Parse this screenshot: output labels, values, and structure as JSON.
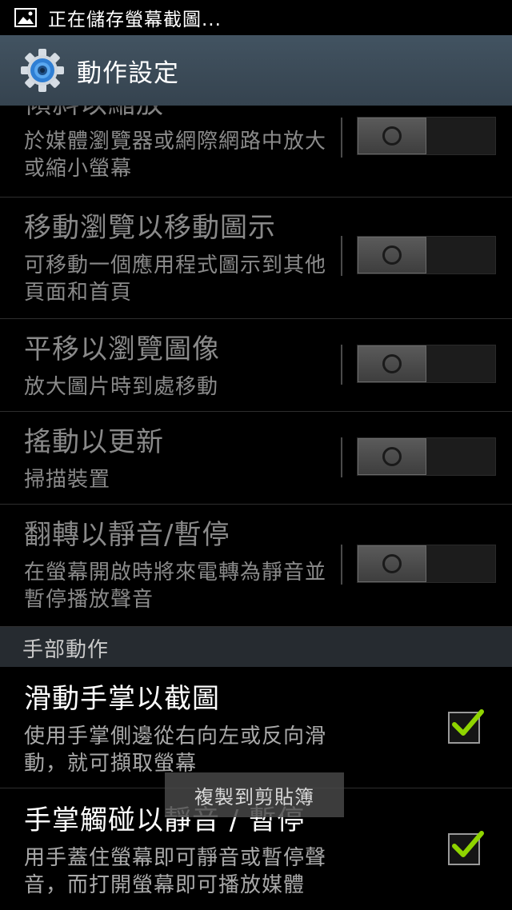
{
  "status_bar": {
    "icon": "image-icon",
    "text": "正在儲存螢幕截圖..."
  },
  "action_bar": {
    "icon": "gear-icon",
    "title": "動作設定"
  },
  "motion_items": [
    {
      "title": "傾斜以縮放",
      "summary": "於媒體瀏覽器或網際網路中放大或縮小螢幕",
      "enabled": false
    },
    {
      "title": "移動瀏覽以移動圖示",
      "summary": "可移動一個應用程式圖示到其他頁面和首頁",
      "enabled": false
    },
    {
      "title": "平移以瀏覽圖像",
      "summary": "放大圖片時到處移動",
      "enabled": false
    },
    {
      "title": "搖動以更新",
      "summary": "掃描裝置",
      "enabled": false
    },
    {
      "title": "翻轉以靜音/暫停",
      "summary": "在螢幕開啟時將來電轉為靜音並暫停播放聲音",
      "enabled": false
    }
  ],
  "hand_section": {
    "header": "手部動作",
    "items": [
      {
        "title": "滑動手掌以截圖",
        "summary": "使用手掌側邊從右向左或反向滑動，就可擷取螢幕",
        "checked": true
      },
      {
        "title": "手掌觸碰以靜音 / 暫停",
        "summary": "用手蓋住螢幕即可靜音或暫停聲音，而打開螢幕即可播放媒體",
        "checked": true
      }
    ]
  },
  "toast": {
    "text": "複製到剪貼簿"
  },
  "colors": {
    "action_bar": "#3b4a56",
    "check_green": "#8fd400",
    "section_header_bg": "#262b30"
  }
}
